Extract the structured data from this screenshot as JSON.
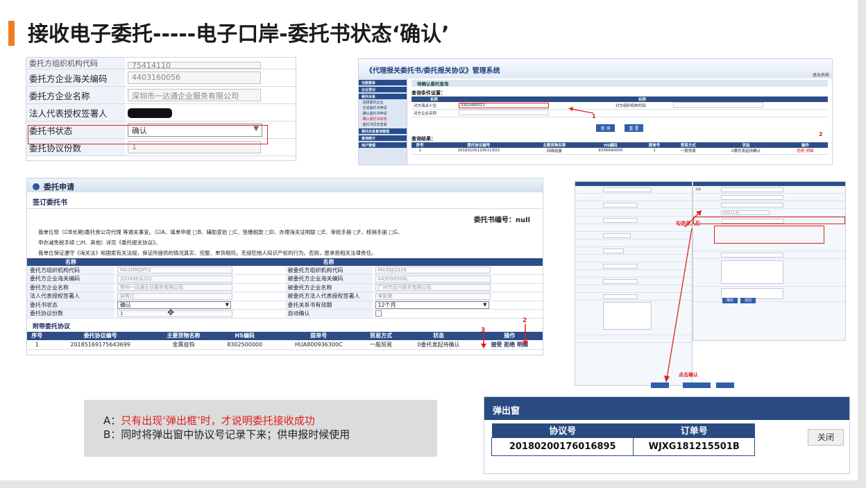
{
  "title": "接收电子委托-----电子口岸-委托书状态‘确认’",
  "panel1": {
    "partial_label": "委托方组织机构代码",
    "partial_value": "75414110",
    "rows": [
      {
        "label": "委托方企业海关编码",
        "value": "4403160056"
      },
      {
        "label": "委托方企业名称",
        "value": "深圳市一达通企业服务有限公司"
      },
      {
        "label": "法人代表授权签署人",
        "value": ""
      },
      {
        "label": "委托书状态",
        "value": "确认"
      },
      {
        "label": "委托协议份数",
        "value": "1"
      }
    ]
  },
  "panel2": {
    "system_title": "《代理报关委托书/委托报关协议》管理系统",
    "top_link": "退出系统",
    "sub_header": "待确认委托查询",
    "query_section": "查询条件设置：",
    "q_head": [
      "名称",
      "",
      "名称",
      ""
    ],
    "q_rows": [
      {
        "l1": "对方海关十位",
        "v1": "3302480021",
        "l2": "对方组织机构代码",
        "v2": ""
      },
      {
        "l1": "对方企业名称",
        "v1": "",
        "l2": "",
        "v2": ""
      }
    ],
    "btn_query": "查 询",
    "btn_reset": "重 置",
    "result_section": "查询结果：",
    "r_head": [
      "序号",
      "委托协议编号",
      "主要货物名称",
      "HS编码",
      "提单号",
      "贸易方式",
      "状态",
      "操作"
    ],
    "r_row": [
      "1",
      "201831051205113O3",
      "冈络结露",
      "8336690000",
      "1",
      "一般贸易",
      "0委托发起待确认",
      "拒绝 明细"
    ],
    "annot1": "1",
    "annot2": "2",
    "sidebar": [
      "功能菜单",
      "企业登记",
      "委托关系",
      "·选择委托企业",
      "·生成委托书申请",
      "·确认委托书申请",
      "·确认委托书状态",
      "·委托书历史查看",
      "委托关系查询管理",
      "查询统计",
      "用户管理"
    ]
  },
  "panel3": {
    "header": "委托申请",
    "sub": "签订委托书",
    "number_label": "委托书编号：null",
    "agree_line1": "我单位现（☑B长期)委托贵公司代理 等通关事宜。（☑A、填单申报 □B、辅助查验 □C、垫缴税款 □D、办理海关证明联 □E、审批手册 □F、核销手册 □G、",
    "agree_line2": "申办减免税手续 □H、其他）详见《委托报关协议》。",
    "agree_line3": "我单位保证遵守《海关法》和国家有关法规，保证所提供的情况真实、完整、单货相符。无侵犯他人知识产权的行为。否则，愿承担相关法律责任。",
    "form_head": [
      "名称",
      "",
      "名称",
      ""
    ],
    "form_rows": [
      {
        "l1": "委托方组织机构代码",
        "v1": "MA1MNQPY2",
        "l2": "被委托方组织机构代码",
        "v2": "MA5BJQ3X8"
      },
      {
        "l1": "委托方企业海关编码",
        "v1": "3204963U10",
        "l2": "被委托方企业海关编码",
        "v2": "443099506L"
      },
      {
        "l1": "委托方企业名称",
        "v1": "常州一达通企业服务有限公司",
        "l2": "被委托方企业名称",
        "v2": "广州市迈兴报关有限公司"
      },
      {
        "l1": "法人代表授权签署人",
        "v1": "钟秀江",
        "l2": "被委托方法人代表授权签署人",
        "v2": "李凯荣"
      }
    ],
    "status_label": "委托书状态",
    "status_value": "确认",
    "validity_label": "委托关系书有效期",
    "validity_value": "12个月",
    "copies_label": "委托协议份数",
    "copies_value": "1",
    "auto_label": "自动确认",
    "attach_title": "附带委托协议",
    "attach_head": [
      "序号",
      "委托协议编号",
      "主要货物名称",
      "HS编码",
      "提单号",
      "贸易方式",
      "状态",
      "操作"
    ],
    "attach_row": [
      "1",
      "20185169175643699",
      "金属挂钩",
      "8302500000",
      "HUA800936300C",
      "一般贸易",
      "0委托发起待确认",
      "接受 拒绝 明细"
    ],
    "annot3": "3",
    "annot2": "2"
  },
  "panel4": {
    "annot_select": "勾选录入后",
    "annot_click": "点击确认",
    "btn_confirm": "确定",
    "btn_return": "返回",
    "dates": [
      "2018.11.28"
    ],
    "right_head": "名称"
  },
  "popup": {
    "title": "弹出窗",
    "col1": "协议号",
    "col2": "订单号",
    "agreement_no": "20180200176016895",
    "order_no": "WJXG181215501B",
    "close_label": "关闭"
  },
  "note": {
    "line_a_prefix": "A：",
    "line_a_text": "只有出现‘弹出框’时，才说明委托接收成功",
    "line_b": "B：同时将弹出窗中协议号记录下来；供申报时候使用"
  },
  "colors": {
    "accent": "#f07c22",
    "table_header": "#2d4d86",
    "annotation": "#e02020"
  }
}
